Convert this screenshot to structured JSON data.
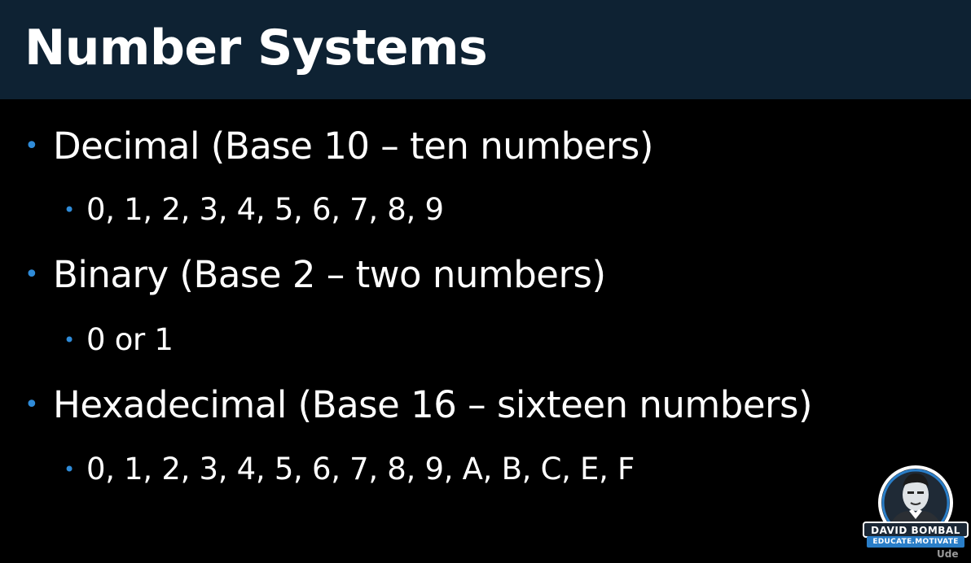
{
  "slide": {
    "title": "Number Systems",
    "bullets": [
      {
        "label": "Decimal (Base 10 – ten numbers)",
        "sub": "0, 1, 2, 3, 4, 5, 6, 7, 8, 9"
      },
      {
        "label": "Binary (Base 2 – two numbers)",
        "sub": "0 or 1"
      },
      {
        "label": "Hexadecimal (Base 16 – sixteen numbers)",
        "sub": "0, 1, 2, 3, 4, 5, 6, 7, 8, 9, A, B, C, E, F"
      }
    ],
    "bullet_glyph": "•"
  },
  "logo": {
    "name": "DAVID BOMBAL",
    "tagline": "EDUCATE.MOTIVATE"
  },
  "watermark": {
    "text": "Ude"
  },
  "colors": {
    "title_bar": "#0e2233",
    "background": "#000000",
    "bullet": "#2f8bd8",
    "text": "#ffffff",
    "logo_ring": "#2a7ec8"
  }
}
